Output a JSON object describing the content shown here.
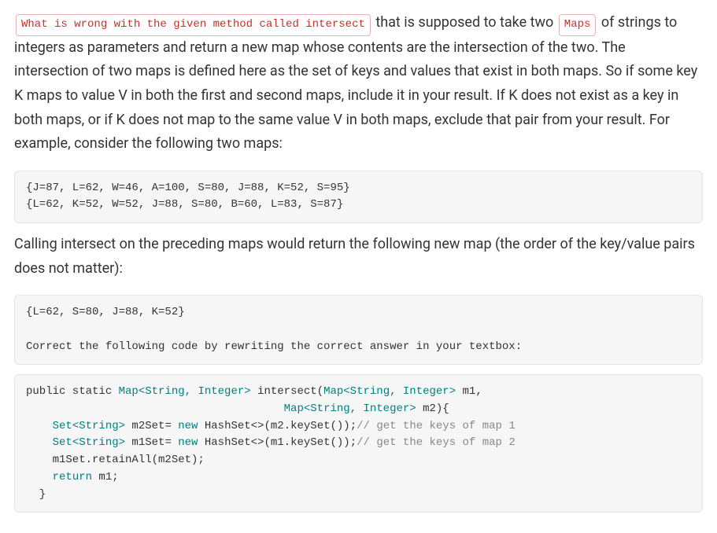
{
  "intro": {
    "tag1": "What is wrong with the given method called intersect",
    "text1": " that is supposed to take two ",
    "tag2": "Maps",
    "text2": " of strings to integers as parameters and return a new map whose contents are the intersection of the two. The intersection of two maps is defined here as the set of keys and values that exist in both maps. So if some key K maps to value V in both the first and second maps, include it in your result. If K does not exist as a key in both maps, or if K does not map to the same value V in both maps, exclude that pair from your result. For example, consider the following two maps:"
  },
  "maps_example": "{J=87, L=62, W=46, A=100, S=80, J=88, K=52, S=95}\n{L=62, K=52, W=52, J=88, S=80, B=60, L=83, S=87}",
  "call_text": "Calling intersect on the preceding maps would return the following new map (the order of the key/value pairs does not matter):",
  "result_map": "{L=62, S=80, J=88, K=52}",
  "instruction": "Correct the following code by rewriting the correct answer in your textbox:",
  "code": {
    "l1a": "public static ",
    "l1b": "Map<String, Integer>",
    "l1c": " intersect(",
    "l1d": "Map<String, Integer>",
    "l1e": " m1,",
    "l2a": "                                       ",
    "l2b": "Map<String, Integer>",
    "l2c": " m2){",
    "l3a": "    ",
    "l3b": "Set<String>",
    "l3c": " m2Set= ",
    "l3d": "new",
    "l3e": " HashSet<>(m2.keySet());",
    "l3f": "// get the keys of map 1",
    "l4a": "    ",
    "l4b": "Set<String>",
    "l4c": " m1Set= ",
    "l4d": "new",
    "l4e": " HashSet<>(m1.keySet());",
    "l4f": "// get the keys of map 2",
    "l5": "    m1Set.retainAll(m2Set);",
    "l6a": "    ",
    "l6b": "return",
    "l6c": " m1;",
    "l7": "  }"
  }
}
